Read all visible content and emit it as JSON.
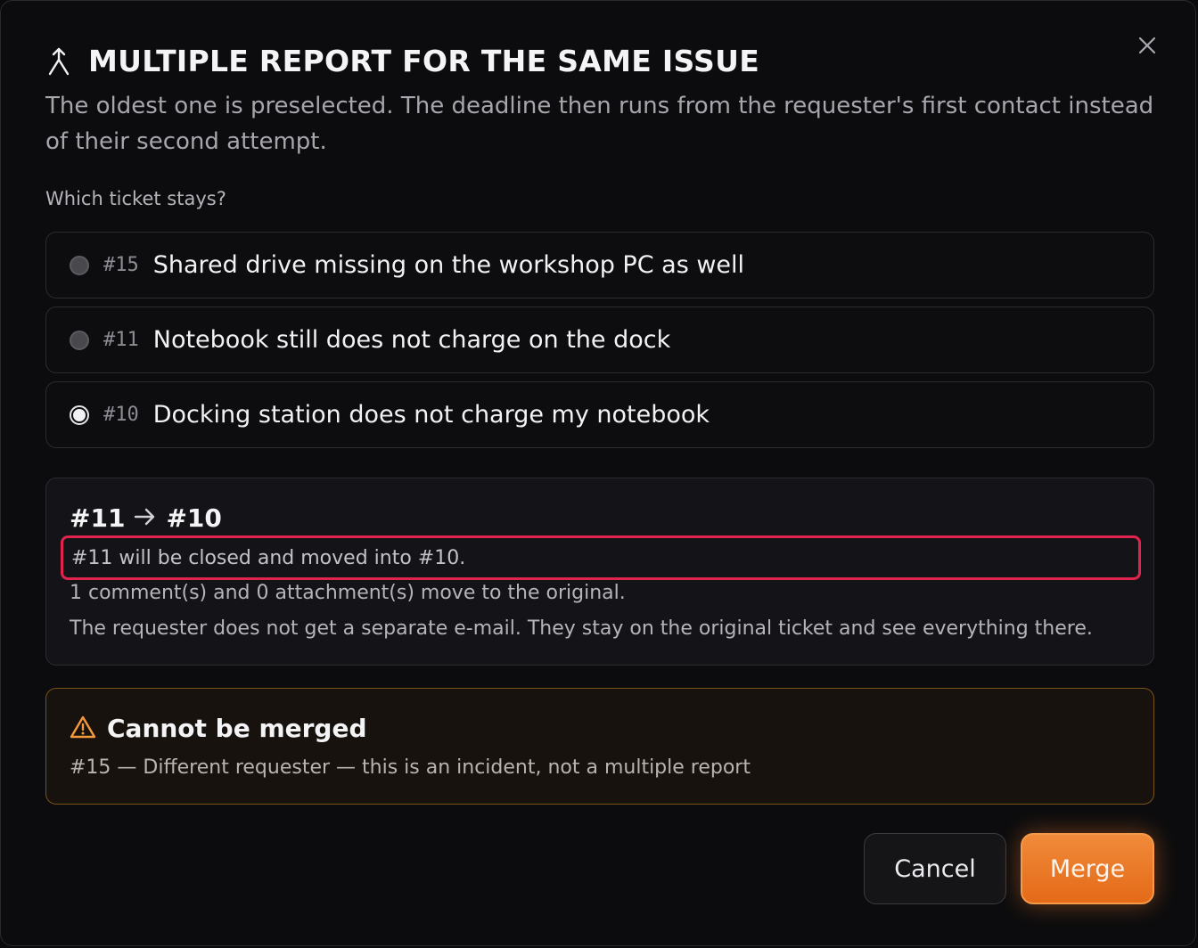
{
  "dialog": {
    "title": "MULTIPLE REPORT FOR THE SAME ISSUE",
    "subtitle": "The oldest one is preselected. The deadline then runs from the requester's first contact instead of their second attempt.",
    "question": "Which ticket stays?",
    "close_icon": "close-icon",
    "title_icon": "merge-icon"
  },
  "options": [
    {
      "id": "#15",
      "label": "Shared drive missing on the workshop PC as well",
      "selected": false
    },
    {
      "id": "#11",
      "label": "Notebook still does not charge on the dock",
      "selected": false
    },
    {
      "id": "#10",
      "label": "Docking station does not charge my notebook",
      "selected": true
    }
  ],
  "summary": {
    "from": "#11",
    "to": "#10",
    "line1": "#11 will be closed and moved into #10.",
    "line2": "1 comment(s) and 0 attachment(s) move to the original.",
    "line3": "The requester does not get a separate e-mail. They stay on the original ticket and see everything there."
  },
  "warning": {
    "title": "Cannot be merged",
    "text": "#15 — Different requester — this is an incident, not a multiple report",
    "color": "#f59a3c"
  },
  "buttons": {
    "cancel": "Cancel",
    "merge": "Merge"
  },
  "colors": {
    "accent": "#ec7a2a",
    "highlight_border": "#e0244e"
  }
}
